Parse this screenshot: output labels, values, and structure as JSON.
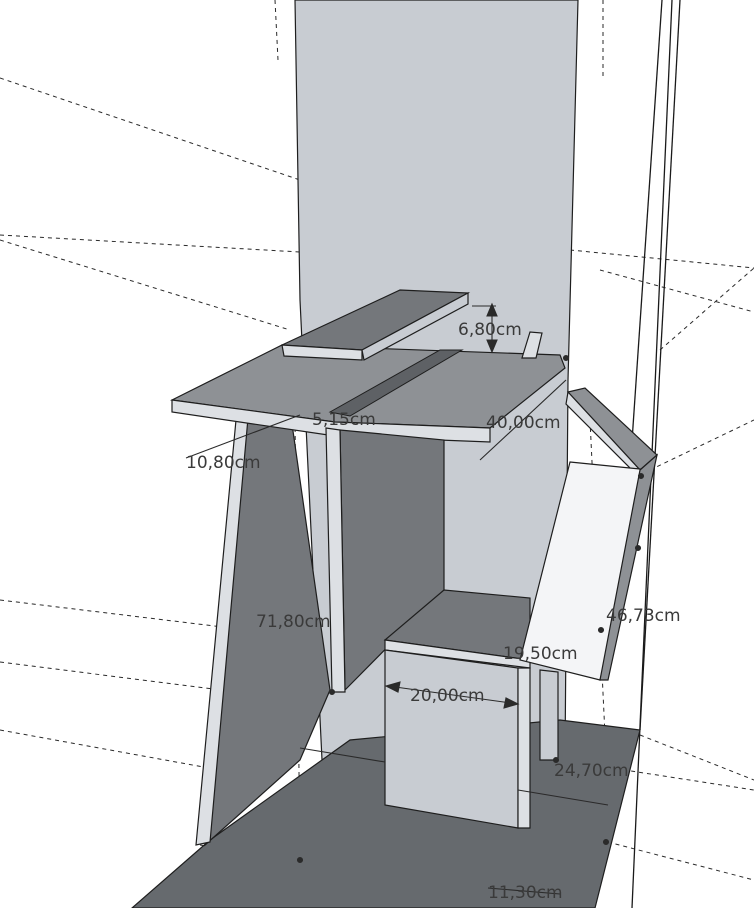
{
  "dimensions": {
    "shelf_height": "6,80cm",
    "slot_width": "5,15cm",
    "shelf_depth": "10,80cm",
    "desk_depth": "40,00cm",
    "total_height": "71,80cm",
    "flap_length": "46,73cm",
    "ledge_depth": "19,50cm",
    "cubby_width": "20,00cm",
    "base_depth": "24,70cm",
    "foot_width": "11,30cm"
  },
  "colors": {
    "background": "#ffffff",
    "wall_face": "#c8ccd2",
    "dark_face": "#74777b",
    "mid_face": "#8e9195",
    "light_face": "#dde0e4",
    "floor": "#666a6e",
    "edge": "#1e1e1e",
    "guide": "#2a2a2a"
  }
}
